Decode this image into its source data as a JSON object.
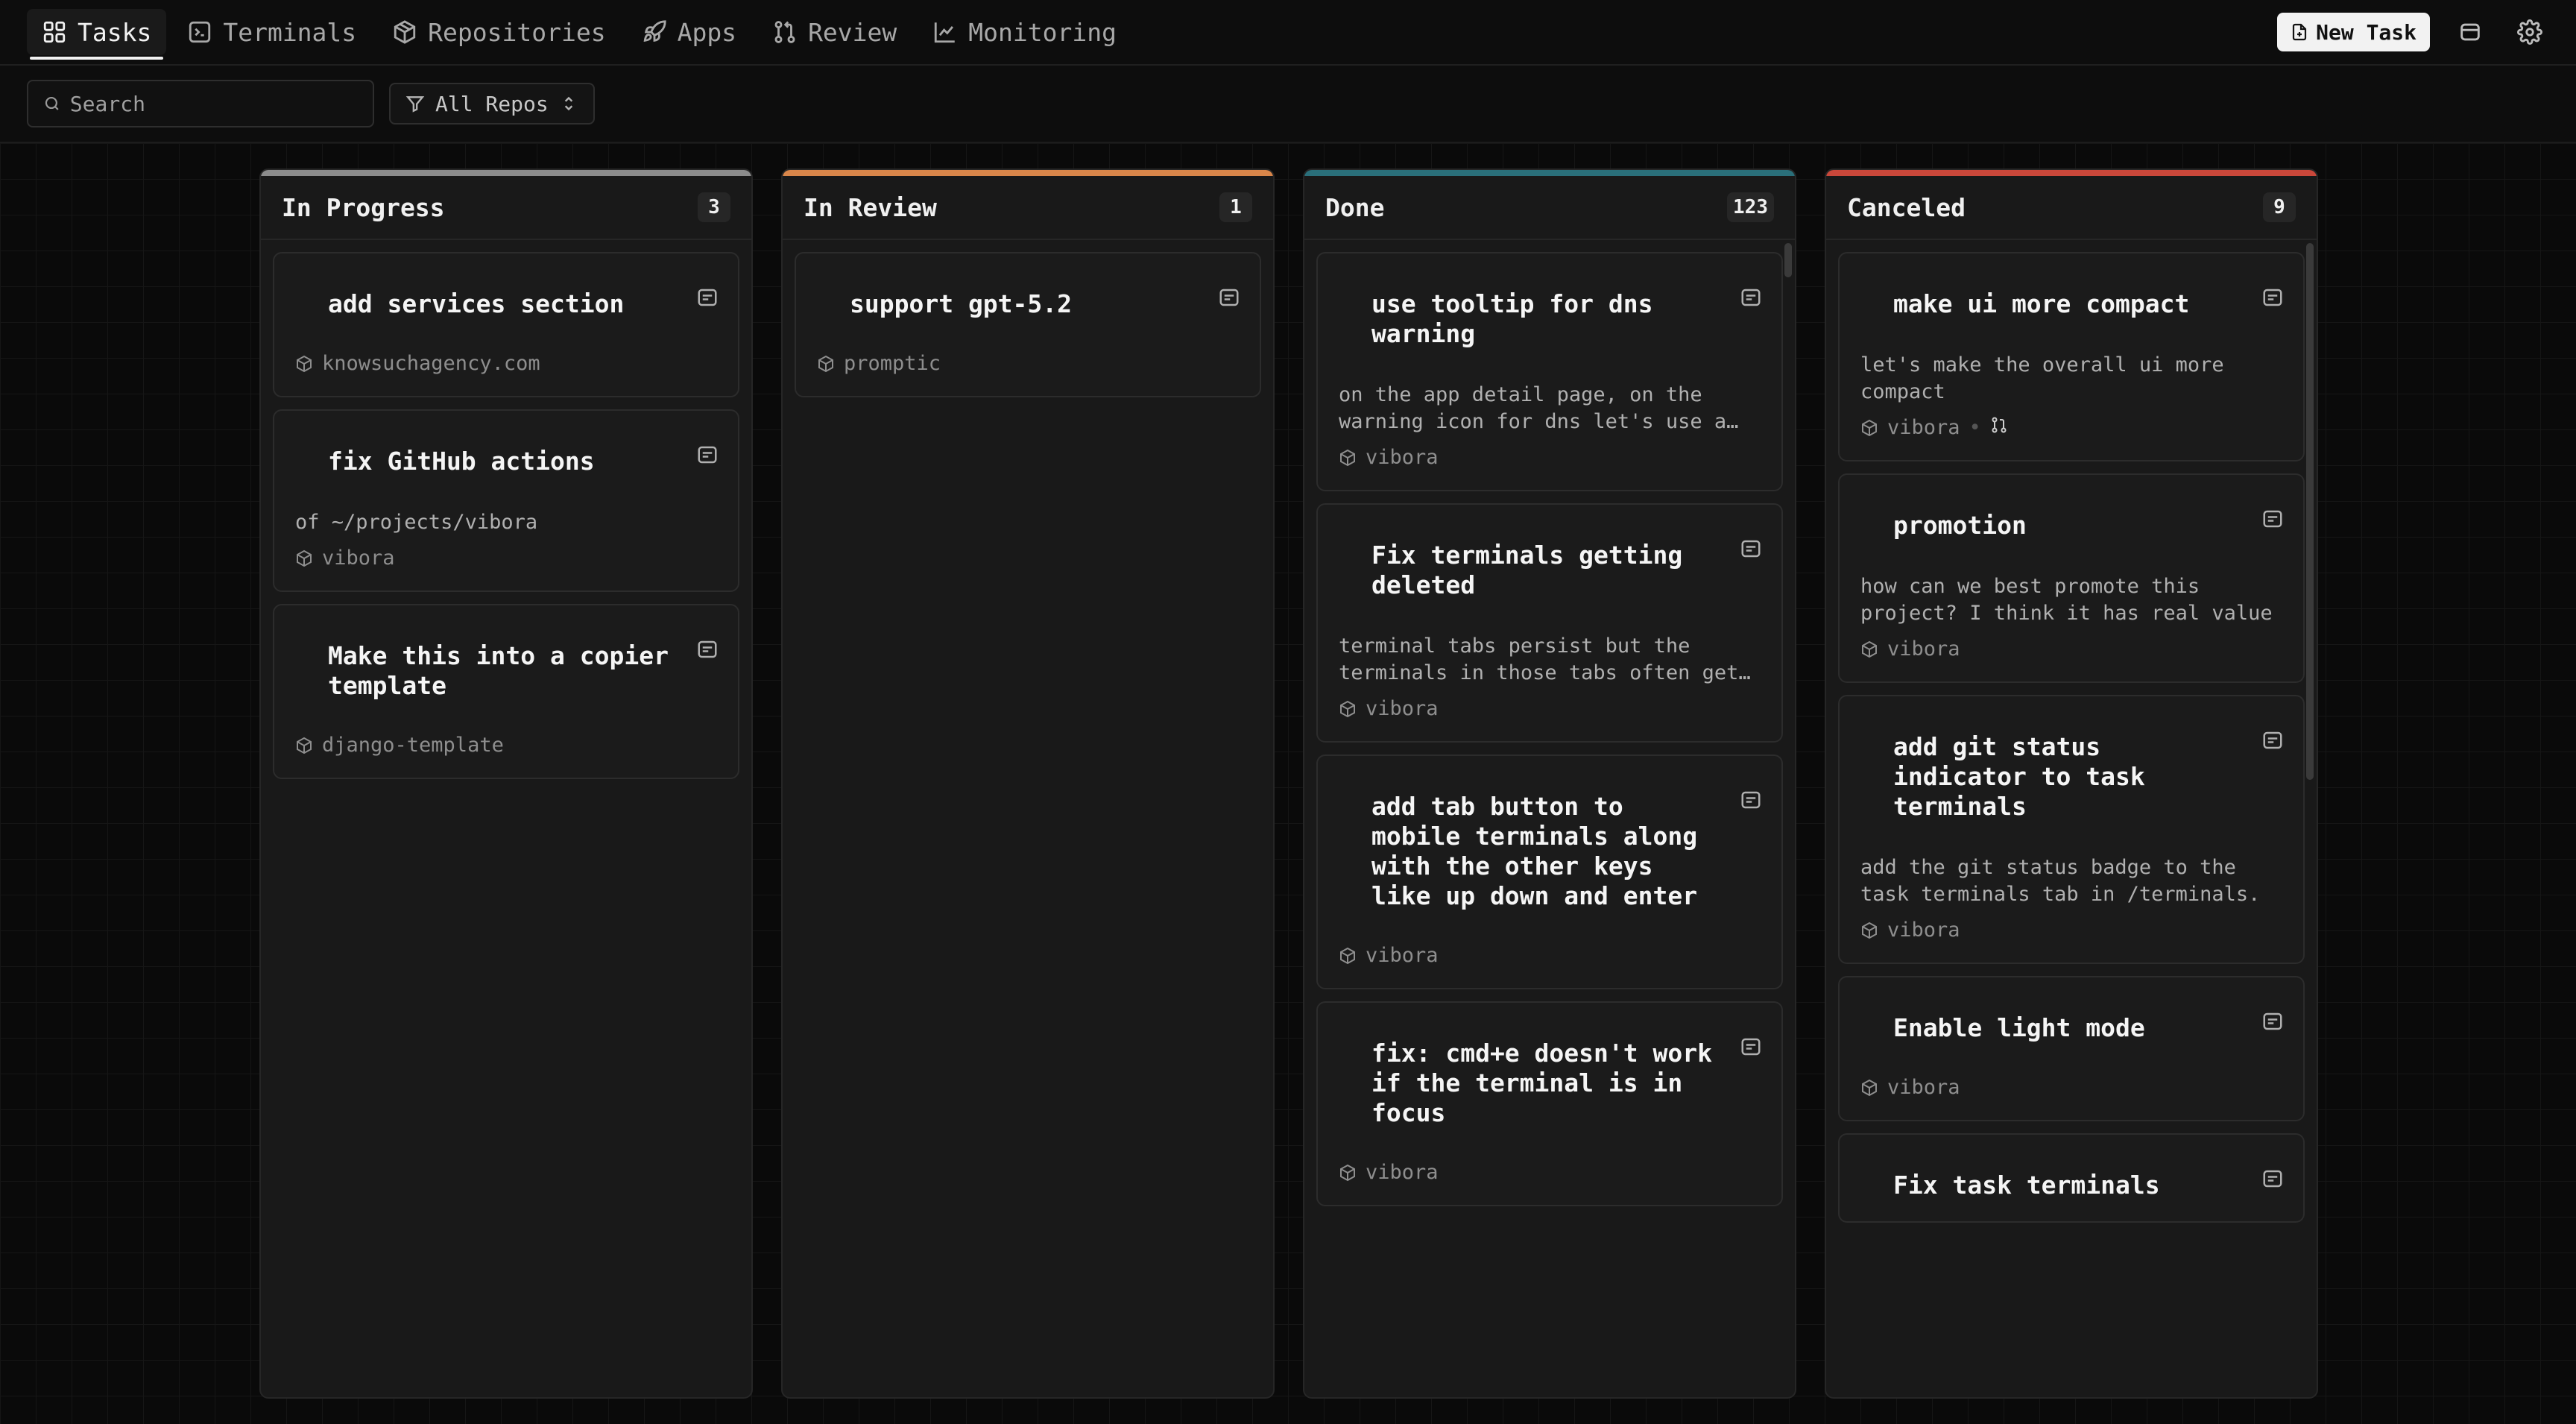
{
  "nav": {
    "items": [
      {
        "label": "Tasks",
        "icon": "grid-icon",
        "active": true
      },
      {
        "label": "Terminals",
        "icon": "terminal-icon",
        "active": false
      },
      {
        "label": "Repositories",
        "icon": "package-icon",
        "active": false
      },
      {
        "label": "Apps",
        "icon": "rocket-icon",
        "active": false
      },
      {
        "label": "Review",
        "icon": "git-pull-request-icon",
        "active": false
      },
      {
        "label": "Monitoring",
        "icon": "chart-line-icon",
        "active": false
      }
    ]
  },
  "toolbar": {
    "new_task_label": "New Task",
    "panel_icon": "panel-icon",
    "settings_icon": "gear-icon"
  },
  "filters": {
    "search_placeholder": "Search",
    "repo_filter_label": "All Repos"
  },
  "columns": [
    {
      "title": "In Progress",
      "count": "3",
      "accent": "#8c8c8c",
      "cards": [
        {
          "title": "add services section",
          "desc": "",
          "repo": "knowsuchagency.com"
        },
        {
          "title": "fix GitHub actions",
          "desc": "of ~/projects/vibora",
          "repo": "vibora"
        },
        {
          "title": "Make this into a copier template",
          "desc": "",
          "repo": "django-template"
        }
      ]
    },
    {
      "title": "In Review",
      "count": "1",
      "accent": "#d9864a",
      "cards": [
        {
          "title": "support gpt-5.2",
          "desc": "",
          "repo": "promptic"
        }
      ]
    },
    {
      "title": "Done",
      "count": "123",
      "accent": "#2a6f7a",
      "cards": [
        {
          "title": "use tooltip for dns warning",
          "desc": "on the app detail page, on the warning icon for dns let's use a tooltip",
          "repo": "vibora"
        },
        {
          "title": "Fix terminals getting deleted",
          "desc": "terminal tabs persist but the terminals in those tabs often get deleted",
          "repo": "vibora"
        },
        {
          "title": "add tab button to mobile terminals along with the other keys like up down and enter",
          "desc": "",
          "repo": "vibora"
        },
        {
          "title": "fix: cmd+e doesn't work if the terminal is in focus",
          "desc": "",
          "repo": "vibora"
        }
      ]
    },
    {
      "title": "Canceled",
      "count": "9",
      "accent": "#c9473a",
      "cards": [
        {
          "title": "make ui more compact",
          "desc": "let's make the overall ui more compact",
          "repo": "vibora",
          "pr": true
        },
        {
          "title": "promotion",
          "desc": "how can we best promote this project? I think it has real value",
          "repo": "vibora"
        },
        {
          "title": "add git status indicator to task terminals",
          "desc": "add the git status badge to the task terminals tab in /terminals.",
          "repo": "vibora"
        },
        {
          "title": "Enable light mode",
          "desc": "",
          "repo": "vibora"
        },
        {
          "title": "Fix task terminals",
          "desc": "",
          "repo": ""
        }
      ]
    }
  ]
}
